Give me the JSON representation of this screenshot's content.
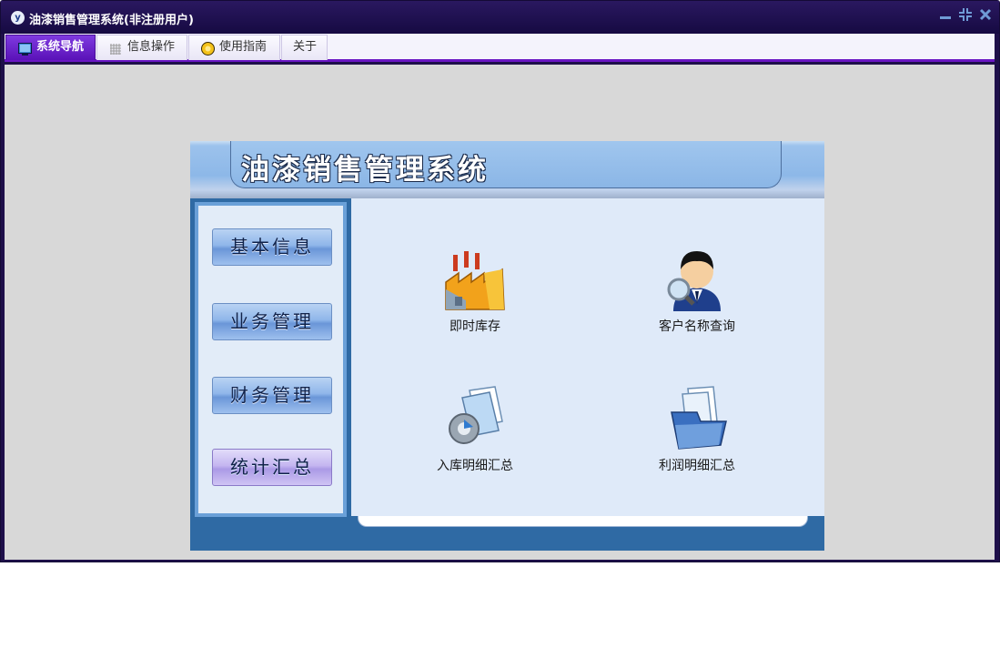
{
  "window": {
    "title": "油漆销售管理系统(非注册用户)",
    "app_icon": "app-logo-icon",
    "controls": [
      "minimize",
      "restore",
      "close"
    ]
  },
  "menu": {
    "tabs": [
      {
        "label": "系统导航",
        "icon": "monitor-icon",
        "active": true
      },
      {
        "label": "信息操作",
        "icon": "grid-icon",
        "active": false
      },
      {
        "label": "使用指南",
        "icon": "help-icon",
        "active": false
      },
      {
        "label": "关于",
        "icon": "",
        "active": false
      }
    ]
  },
  "panel": {
    "title": "油漆销售管理系统",
    "nav": [
      {
        "label": "基本信息"
      },
      {
        "label": "业务管理"
      },
      {
        "label": "财务管理"
      },
      {
        "label": "统计汇总",
        "selected": true
      }
    ],
    "functions": [
      {
        "label": "即时库存",
        "icon": "factory-icon"
      },
      {
        "label": "客户名称查询",
        "icon": "user-search-icon"
      },
      {
        "label": "入库明细汇总",
        "icon": "gear-document-icon"
      },
      {
        "label": "利润明细汇总",
        "icon": "folder-documents-icon"
      }
    ]
  },
  "colors": {
    "titlebar": "#1e0f4a",
    "menu_accent": "#6a16c4",
    "workspace": "#d8d8d8",
    "panel_frame": "#2f6aa4",
    "content_bg": "#dfeaf9"
  }
}
